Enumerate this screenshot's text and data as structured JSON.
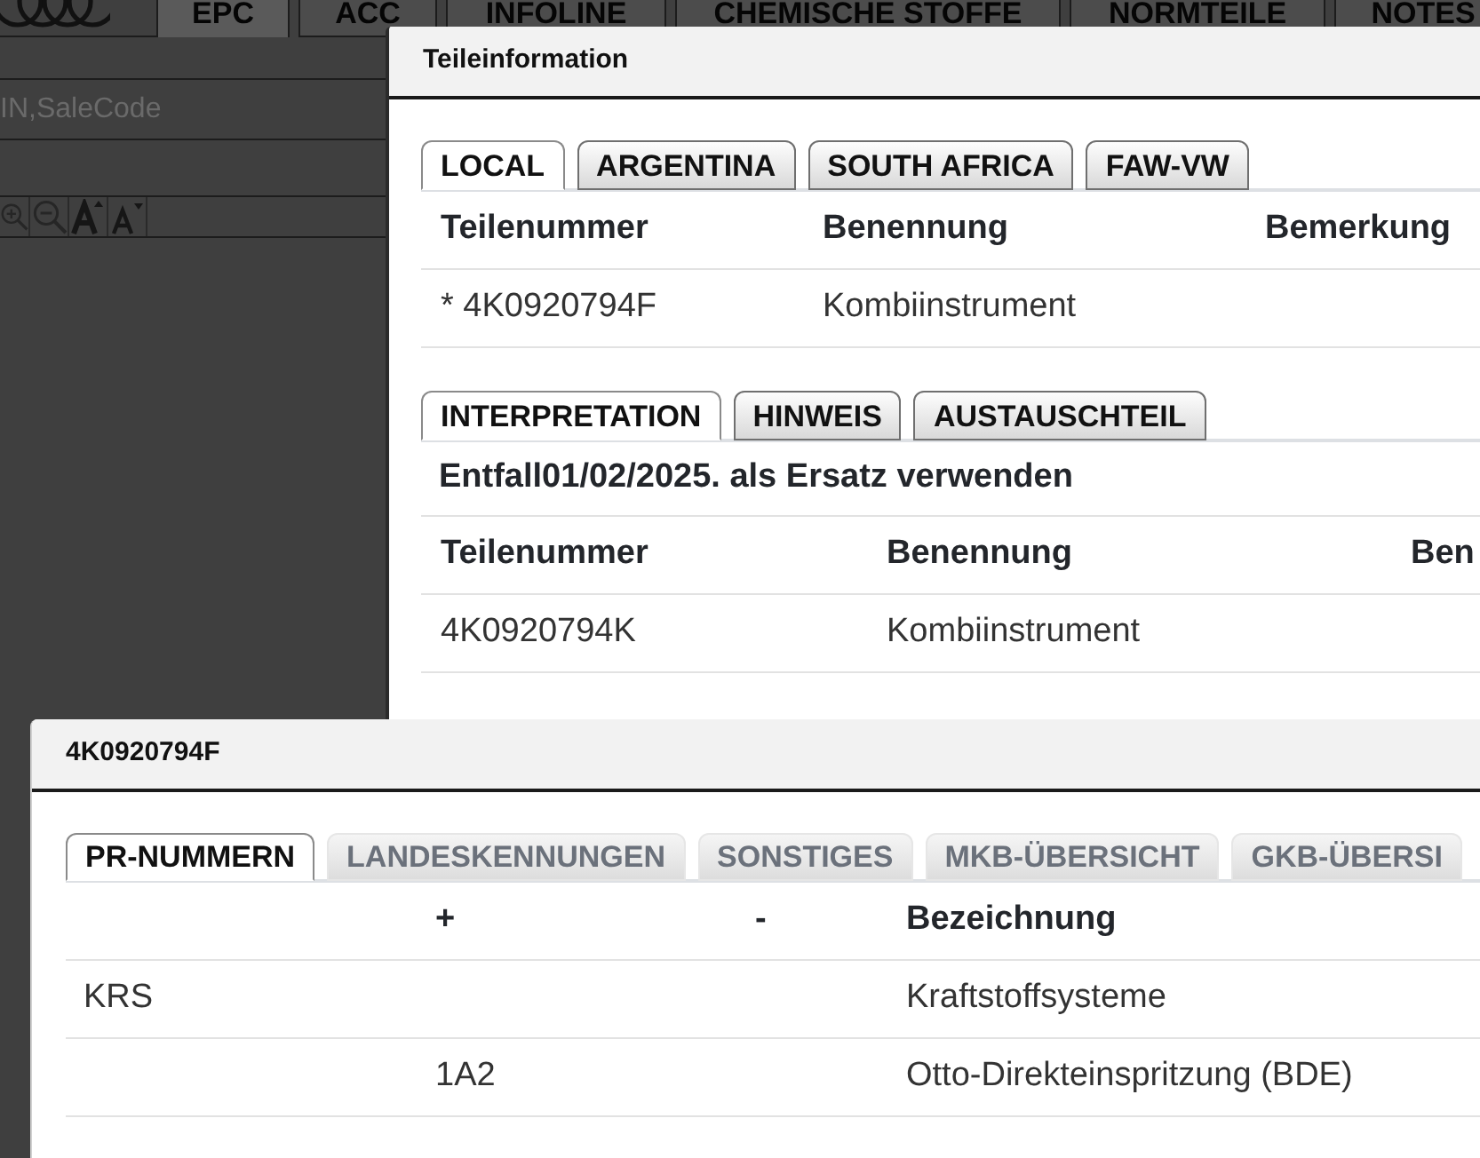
{
  "app": {
    "tabs": [
      {
        "label": "EPC",
        "selected": true
      },
      {
        "label": "ACC",
        "selected": false
      },
      {
        "label": "INFOLINE",
        "selected": false
      },
      {
        "label": "CHEMISCHE STOFFE",
        "selected": false
      },
      {
        "label": "NORMTEILE",
        "selected": false
      },
      {
        "label": "NOTES",
        "selected": false
      }
    ],
    "search": {
      "placeholder": "IN,SaleCode"
    }
  },
  "teileinformation": {
    "title": "Teileinformation",
    "region_tabs": [
      {
        "label": "LOCAL",
        "selected": true
      },
      {
        "label": "ARGENTINA",
        "selected": false
      },
      {
        "label": "SOUTH AFRICA",
        "selected": false
      },
      {
        "label": "FAW-VW",
        "selected": false
      }
    ],
    "parts_table": {
      "columns": [
        "Teilenummer",
        "Benennung",
        "Bemerkung"
      ],
      "rows": [
        [
          "* 4K0920794F",
          "Kombiinstrument",
          null
        ]
      ]
    },
    "detail_tabs": [
      {
        "label": "INTERPRETATION",
        "selected": true
      },
      {
        "label": "HINWEIS",
        "selected": false
      },
      {
        "label": "AUSTAUSCHTEIL",
        "selected": false
      }
    ],
    "note": "Entfall01/02/2025. als Ersatz verwenden",
    "replacement_table": {
      "columns": [
        "Teilenummer",
        "Benennung",
        "Ben"
      ],
      "rows": [
        [
          "4K0920794K",
          "Kombiinstrument",
          null
        ]
      ]
    }
  },
  "part_dialog": {
    "title": "4K0920794F",
    "tabs": [
      {
        "label": "PR-NUMMERN",
        "selected": true,
        "disabled": false
      },
      {
        "label": "LANDESKENNUNGEN",
        "selected": false,
        "disabled": true
      },
      {
        "label": "SONSTIGES",
        "selected": false,
        "disabled": true
      },
      {
        "label": "MKB-ÜBERSICHT",
        "selected": false,
        "disabled": true
      },
      {
        "label": "GKB-ÜBERSI",
        "selected": false,
        "disabled": true
      }
    ],
    "table": {
      "columns": [
        null,
        "+",
        "-",
        "Bezeichnung"
      ],
      "rows": [
        [
          "KRS",
          null,
          null,
          "Kraftstoffsysteme"
        ],
        [
          null,
          "1A2",
          null,
          "Otto-Direkteinspritzung (BDE)"
        ]
      ]
    }
  }
}
